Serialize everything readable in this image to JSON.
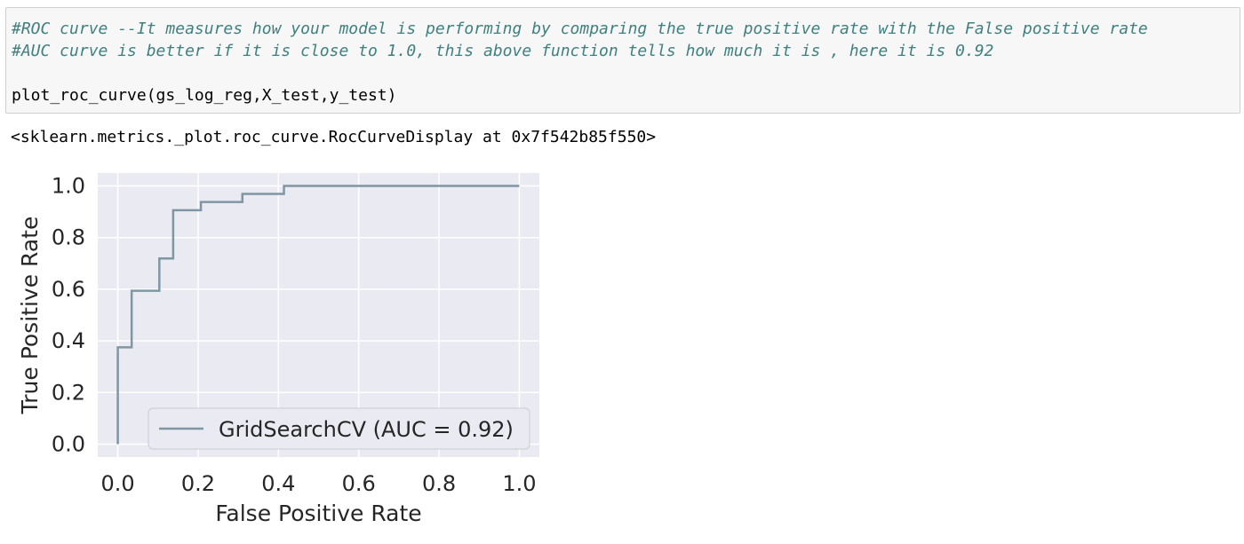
{
  "notebook": {
    "input_cell": {
      "lines": [
        "#ROC curve --It measures how your model is performing by comparing the true positive rate with the False positive rate",
        "#AUC curve is better if it is close to 1.0, this above function tells how much it is , here it is 0.92",
        "",
        "plot_roc_curve(gs_log_reg,X_test,y_test)"
      ]
    },
    "output_repr": "<sklearn.metrics._plot.roc_curve.RocCurveDisplay at 0x7f542b85f550>"
  },
  "chart_data": {
    "type": "line",
    "xlabel": "False Positive Rate",
    "ylabel": "True Positive Rate",
    "xlim": [
      -0.05,
      1.05
    ],
    "ylim": [
      -0.05,
      1.05
    ],
    "x_ticks": [
      "0.0",
      "0.2",
      "0.4",
      "0.6",
      "0.8",
      "1.0"
    ],
    "y_ticks": [
      "0.0",
      "0.2",
      "0.4",
      "0.6",
      "0.8",
      "1.0"
    ],
    "grid": true,
    "legend_position": "lower-right",
    "series": [
      {
        "name": "GridSearchCV (AUC = 0.92)",
        "color": "#7f96a3",
        "x": [
          0.0,
          0.0,
          0.0,
          0.0345,
          0.0345,
          0.1034,
          0.1034,
          0.1379,
          0.1379,
          0.2069,
          0.2069,
          0.3103,
          0.3103,
          0.4138,
          0.4138,
          1.0
        ],
        "y": [
          0.0,
          0.031,
          0.375,
          0.375,
          0.594,
          0.594,
          0.719,
          0.719,
          0.906,
          0.906,
          0.938,
          0.938,
          0.969,
          0.969,
          1.0,
          1.0
        ]
      }
    ],
    "background": "#eaeaf2",
    "grid_color": "#ffffff"
  }
}
